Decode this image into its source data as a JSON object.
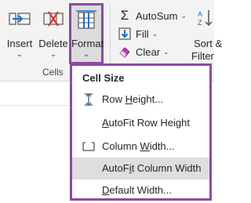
{
  "ribbon": {
    "insert": {
      "label": "Insert",
      "icon": "insert-cells-icon"
    },
    "delete": {
      "label": "Delete",
      "icon": "delete-cells-icon"
    },
    "format": {
      "label": "Format",
      "icon": "format-cells-icon"
    },
    "group_label": "Cells",
    "autosum": {
      "label": "AutoSum",
      "icon": "sigma-icon"
    },
    "fill": {
      "label": "Fill",
      "icon": "fill-down-icon"
    },
    "clear": {
      "label": "Clear",
      "icon": "eraser-icon"
    },
    "sort": {
      "label_line1": "Sort &",
      "label_line2": "Filter",
      "icon": "sort-filter-icon"
    }
  },
  "menu": {
    "header": "Cell Size",
    "items": [
      {
        "pre": "Row ",
        "u": "H",
        "post": "eight...",
        "icon": "row-height-icon"
      },
      {
        "pre": "",
        "u": "A",
        "post": "utoFit Row Height",
        "icon": ""
      },
      {
        "pre": "Column ",
        "u": "W",
        "post": "idth...",
        "icon": "column-width-icon"
      },
      {
        "pre": "AutoF",
        "u": "i",
        "post": "t Column Width",
        "icon": "",
        "highlighted": true
      },
      {
        "pre": "",
        "u": "D",
        "post": "efault Width...",
        "icon": ""
      }
    ]
  },
  "colors": {
    "highlight_border": "#8a4c9e",
    "hover": "#dedede",
    "ribbon_bg": "#f3f3f3"
  }
}
